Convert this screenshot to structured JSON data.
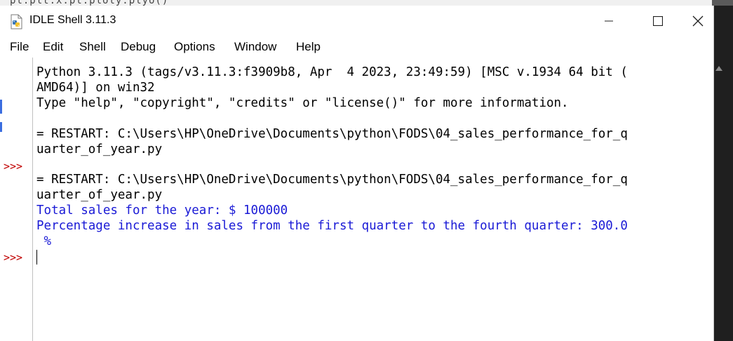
{
  "window": {
    "title": "IDLE Shell 3.11.3",
    "controls": {
      "minimize": "—",
      "maximize": "☐",
      "close": "✕"
    }
  },
  "menu": {
    "items": [
      "File",
      "Edit",
      "Shell",
      "Debug",
      "Options",
      "Window",
      "Help"
    ]
  },
  "shell": {
    "lines": [
      "Python 3.11.3 (tags/v3.11.3:f3909b8, Apr  4 2023, 23:49:59) [MSC v.1934 64 bit (",
      "AMD64)] on win32",
      "Type \"help\", \"copyright\", \"credits\" or \"license()\" for more information.",
      "",
      "= RESTART: C:\\Users\\HP\\OneDrive\\Documents\\python\\FODS\\04_sales_performance_for_q",
      "uarter_of_year.py",
      "",
      "= RESTART: C:\\Users\\HP\\OneDrive\\Documents\\python\\FODS\\04_sales_performance_for_q",
      "uarter_of_year.py"
    ],
    "output": [
      "Total sales for the year: $ 100000",
      "Percentage increase in sales from the first quarter to the fourth quarter: 300.0",
      " %"
    ],
    "prompts": [
      ">>>",
      ">>>"
    ]
  },
  "background": {
    "ghost_text": "pl.plt.x.pl.ploly.plyo()"
  },
  "colors": {
    "prompt": "#c00000",
    "output": "#1a1ad6",
    "text": "#000000"
  }
}
